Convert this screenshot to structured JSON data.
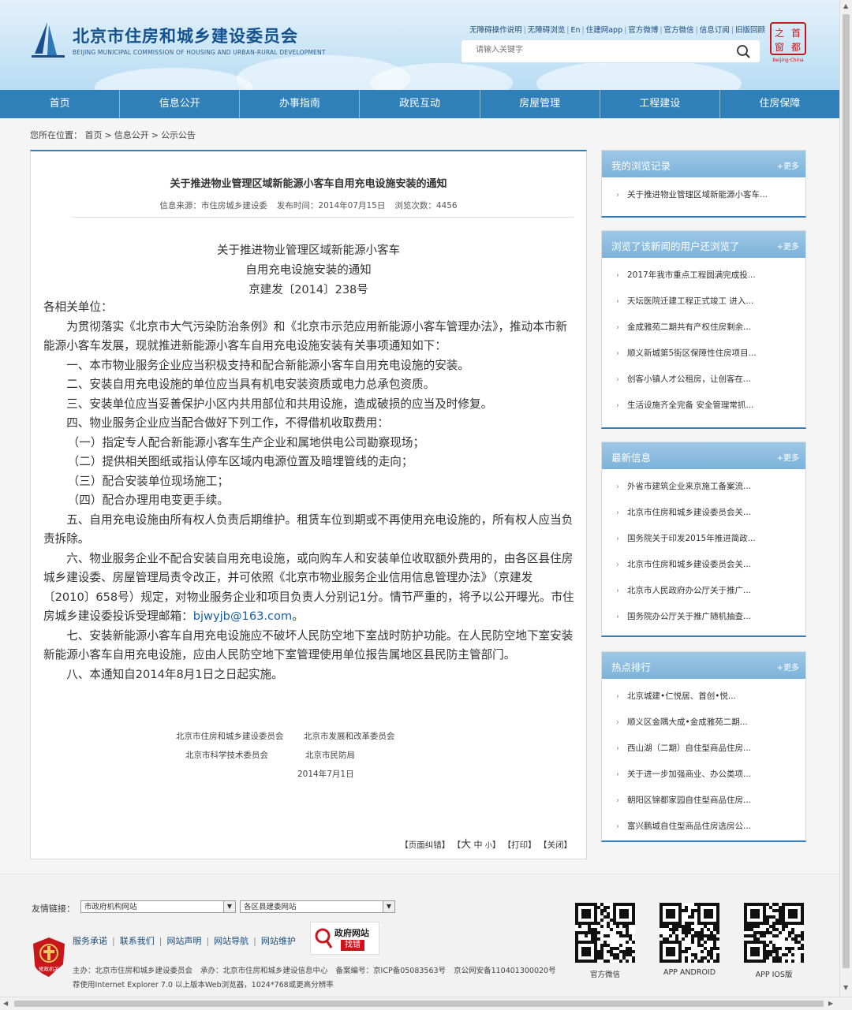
{
  "header": {
    "logo_cn": "北京市住房和城乡建设委员会",
    "logo_en": "BEIJING MUNICIPAL COMMISSION OF HOUSING AND URBAN-RURAL DEVELOPMENT",
    "top_links": [
      "无障碍操作说明",
      "无障碍浏览",
      "En",
      "住建网app",
      "官方微博",
      "官方微信",
      "信息订阅",
      "旧版回顾"
    ],
    "search_placeholder": "请输入关键字",
    "seal_chars": [
      "之",
      "首",
      "窗",
      "都"
    ],
    "seal_caption": "Beijing·China"
  },
  "nav": [
    "首页",
    "信息公开",
    "办事指南",
    "政民互动",
    "房屋管理",
    "工程建设",
    "住房保障"
  ],
  "breadcrumb": {
    "label": "您所在位置：",
    "items": [
      "首页",
      "信息公开",
      "公示公告"
    ],
    "sep": ">"
  },
  "article": {
    "title": "关于推进物业管理区域新能源小客车自用充电设施安装的通知",
    "meta": {
      "source": "信息来源：市住房城乡建设委",
      "date": "发布时间：2014年07月15日",
      "views": "浏览次数：4456"
    },
    "doc_head": [
      "关于推进物业管理区域新能源小客车",
      "自用充电设施安装的通知",
      "京建发〔2014〕238号"
    ],
    "salutation": "各相关单位：",
    "p1": "为贯彻落实《北京市大气污染防治条例》和《北京市示范应用新能源小客车管理办法》，推动本市新能源小客车发展，现就推进新能源小客车自用充电设施安装有关事项通知如下：",
    "items": [
      "一、本市物业服务企业应当积极支持和配合新能源小客车自用充电设施的安装。",
      "二、安装自用充电设施的单位应当具有机电安装资质或电力总承包资质。",
      "三、安装单位应当妥善保护小区内共用部位和共用设施，造成破损的应当及时修复。",
      "四、物业服务企业应当配合做好下列工作，不得借机收取费用："
    ],
    "subitems": [
      "（一）指定专人配合新能源小客车生产企业和属地供电公司勘察现场；",
      "（二）提供相关图纸或指认停车区域内电源位置及暗埋管线的走向；",
      "（三）配合安装单位现场施工；",
      "（四）配合办理用电变更手续。"
    ],
    "p5": "五、自用充电设施由所有权人负责后期维护。租赁车位到期或不再使用充电设施的，所有权人应当负责拆除。",
    "p6": "六、物业服务企业不配合安装自用充电设施，或向购车人和安装单位收取额外费用的，由各区县住房城乡建设委、房屋管理局责令改正，并可依照《北京市物业服务企业信用信息管理办法》（京建发〔2010〕658号）规定，对物业服务企业和项目负责人分别记1分。情节严重的，将予以公开曝光。市住房城乡建设委投诉受理邮箱：",
    "email": "bjwyjb@163.com",
    "p6_end": "。",
    "p7": "七、安装新能源小客车自用充电设施应不破坏人民防空地下室战时防护功能。在人民防空地下室安装新能源小客车自用充电设施，应由人民防空地下室管理使用单位报告属地区县民防主管部门。",
    "p8": "八、本通知自2014年8月1日之日起实施。",
    "sign": {
      "org1": "北京市住房和城乡建设委员会",
      "org2": "北京市发展和改革委员会",
      "org3": "北京市科学技术委员会",
      "org4": "北京市民防局",
      "date": "2014年7月1日"
    },
    "tools": {
      "correct": "【页面纠错】",
      "size_open": "【",
      "size_big": "大",
      "size_mid": "中",
      "size_small": "小",
      "size_close": "】",
      "print": "【打印】",
      "close": "【关闭】"
    }
  },
  "sidebar": {
    "more": "+更多",
    "boxes": [
      {
        "title": "我的浏览记录",
        "items": [
          "关于推进物业管理区域新能源小客车..."
        ]
      },
      {
        "title": "浏览了该新闻的用户还浏览了",
        "items": [
          "2017年我市重点工程圆满完成投...",
          "天坛医院迁建工程正式竣工 进入...",
          "金成雅苑二期共有产权住房剩余...",
          "顺义新城第5街区保障性住房项目...",
          "创客小镇人才公租房，让创客在...",
          "生活设施齐全完备 安全管理常抓..."
        ]
      },
      {
        "title": "最新信息",
        "items": [
          "外省市建筑企业来京施工备案流...",
          "北京市住房和城乡建设委员会关...",
          "国务院关于印发2015年推进简政...",
          "北京市住房和城乡建设委员会关...",
          "北京市人民政府办公厅关于推广...",
          "国务院办公厅关于推广随机抽查..."
        ]
      },
      {
        "title": "热点排行",
        "items": [
          "北京城建•仁悦居、首创•悦...",
          "顺义区金隅大成•金成雅苑二期...",
          "西山湖（二期）自住型商品住房...",
          "关于进一步加强商业、办公类项...",
          "朝阳区锦都家园自住型商品住房...",
          "富兴鹏城自住型商品住房选房公..."
        ]
      }
    ]
  },
  "footer": {
    "friend_label": "友情链接：",
    "select1": "市政府机构网站",
    "select2": "各区县建委网站",
    "links": [
      "服务承诺",
      "联系我们",
      "网站声明",
      "网站导航",
      "网站维护"
    ],
    "gov_t1": "政府网站",
    "gov_t2": "找错",
    "badge_text": "党政机关",
    "info": [
      "主办：北京市住房和城乡建设委员会",
      "承办：北京市住房和城乡建设信息中心",
      "备案编号：京ICP备05083563号",
      "京公网安备110401300020号"
    ],
    "note": "荐使用Internet Explorer 7.0 以上版本Web浏览器，1024*768或更高分辨率",
    "qrs": [
      "官方微信",
      "APP ANDROID",
      "APP IOS版"
    ]
  },
  "colors": {
    "nav": "#2f7fb9",
    "title_blue": "#14518f",
    "box_head": "#8bbce0",
    "link": "#1b4c7c",
    "red": "#c8161d"
  }
}
